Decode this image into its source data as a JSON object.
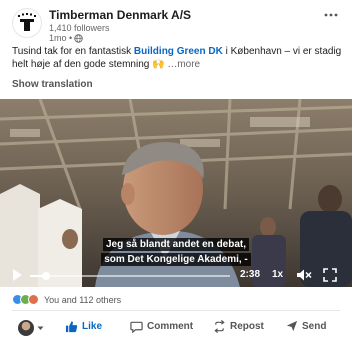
{
  "header": {
    "company_name": "Timberman Denmark A/S",
    "followers": "1,410 followers",
    "time_ago": "1mo •",
    "visibility_icon": "globe-icon",
    "more_icon": "more-horizontal-icon"
  },
  "post": {
    "text_before": "Tusind tak for en fantastisk ",
    "mention": "Building Green DK",
    "text_after": " i København – vi er stadig helt høje af den gode stemning 🙌",
    "see_more": " …more",
    "show_translation": "Show translation"
  },
  "video": {
    "subtitle_line1": "Jeg så blandt andet en debat,",
    "subtitle_line2": "som Det Kongelige Akademi, -",
    "remaining_time": "2:38",
    "speed": "1x",
    "progress": 0.08
  },
  "reactions": {
    "summary": "You and 112 others",
    "icons": [
      "like-reaction-icon",
      "celebrate-reaction-icon",
      "support-reaction-icon"
    ],
    "colors": {
      "like": "#378fe9",
      "celebrate": "#6dae4f",
      "support": "#df704d"
    }
  },
  "actions": {
    "like": "Like",
    "comment": "Comment",
    "repost": "Repost",
    "send": "Send"
  },
  "theme": {
    "accent": "#0a66c2",
    "muted": "#666666"
  }
}
